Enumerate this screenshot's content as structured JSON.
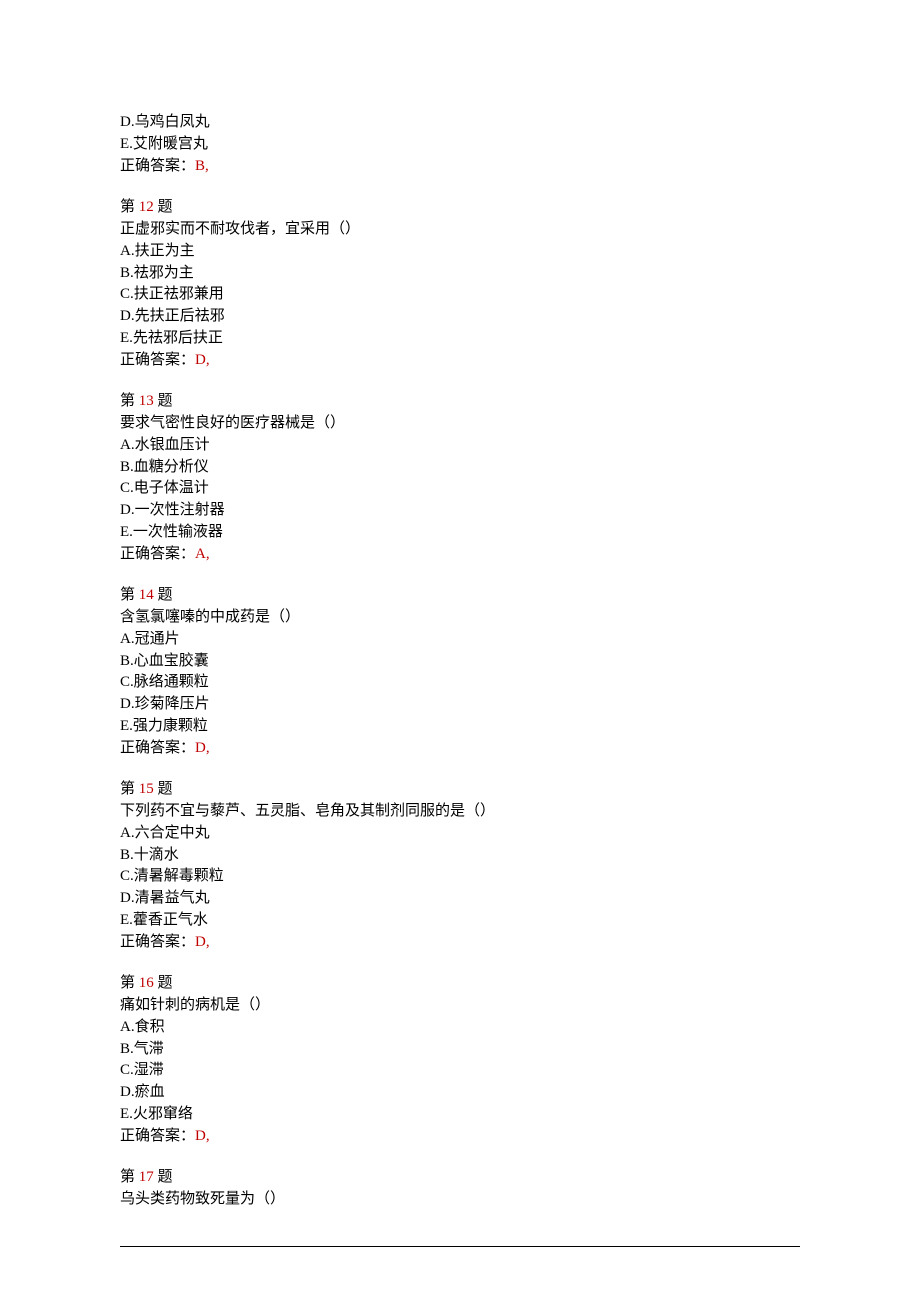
{
  "prelude": {
    "d": "D.乌鸡白凤丸",
    "e": "E.艾附暖宫丸",
    "answer_label": "正确答案：",
    "answer_val": "B,"
  },
  "questions": [
    {
      "num": "12",
      "stem": "正虚邪实而不耐攻伐者，宜采用（）",
      "opts": [
        "A.扶正为主",
        "B.祛邪为主",
        "C.扶正祛邪兼用",
        "D.先扶正后祛邪",
        "E.先祛邪后扶正"
      ],
      "ans": "D,"
    },
    {
      "num": "13",
      "stem": "要求气密性良好的医疗器械是（）",
      "opts": [
        "A.水银血压计",
        "B.血糖分析仪",
        "C.电子体温计",
        "D.一次性注射器",
        "E.一次性输液器"
      ],
      "ans": "A,"
    },
    {
      "num": "14",
      "stem": "含氢氯噻嗪的中成药是（）",
      "opts": [
        "A.冠通片",
        "B.心血宝胶囊",
        "C.脉络通颗粒",
        "D.珍菊降压片",
        "E.强力康颗粒"
      ],
      "ans": "D,"
    },
    {
      "num": "15",
      "stem": "下列药不宜与藜芦、五灵脂、皂角及其制剂同服的是（）",
      "opts": [
        "A.六合定中丸",
        "B.十滴水",
        "C.清暑解毒颗粒",
        "D.清暑益气丸",
        "E.藿香正气水"
      ],
      "ans": "D,"
    },
    {
      "num": "16",
      "stem": "痛如针刺的病机是（）",
      "opts": [
        "A.食积",
        "B.气滞",
        "C.湿滞",
        "D.瘀血",
        "E.火邪窜络"
      ],
      "ans": "D,"
    }
  ],
  "tail": {
    "num": "17",
    "stem": "乌头类药物致死量为（）"
  },
  "labels": {
    "q_prefix": "第 ",
    "q_suffix": " 题",
    "answer_label": "正确答案："
  }
}
